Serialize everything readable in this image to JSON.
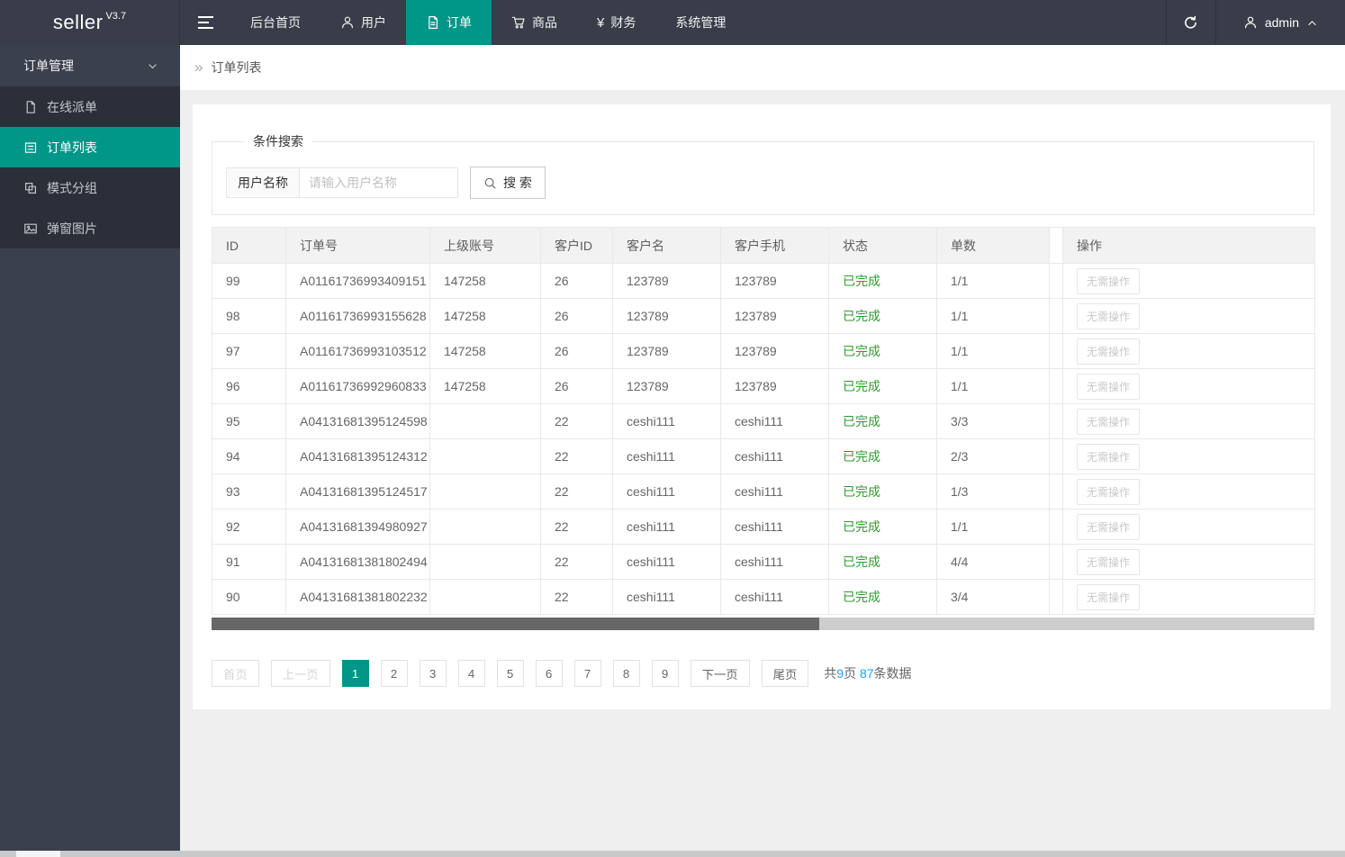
{
  "navbar": {
    "logo": "seller",
    "version": "V3.7",
    "items": [
      {
        "label": "后台首页",
        "icon": "",
        "active": false
      },
      {
        "label": "用户",
        "icon": "user",
        "active": false
      },
      {
        "label": "订单",
        "icon": "document",
        "active": true
      },
      {
        "label": "商品",
        "icon": "cart",
        "active": false
      },
      {
        "label": "财务",
        "icon": "yen",
        "active": false
      },
      {
        "label": "系统管理",
        "icon": "",
        "active": false
      }
    ],
    "username": "admin"
  },
  "sidebar": {
    "group_label": "订单管理",
    "items": [
      {
        "label": "在线派单",
        "icon": "file",
        "active": false
      },
      {
        "label": "订单列表",
        "icon": "list",
        "active": true
      },
      {
        "label": "模式分组",
        "icon": "group",
        "active": false
      },
      {
        "label": "弹窗图片",
        "icon": "image",
        "active": false
      }
    ]
  },
  "breadcrumb": {
    "icon": "»",
    "current": "订单列表"
  },
  "search": {
    "legend": "条件搜索",
    "field_label": "用户名称",
    "placeholder": "请输入用户名称",
    "button_label": "搜 索"
  },
  "table": {
    "headers": [
      "ID",
      "订单号",
      "上级账号",
      "客户ID",
      "客户名",
      "客户手机",
      "状态",
      "单数",
      "",
      "操作"
    ],
    "action_label": "无需操作",
    "rows": [
      [
        "99",
        "A01161736993409151",
        "147258",
        "26",
        "123789",
        "123789",
        "已完成",
        "1/1"
      ],
      [
        "98",
        "A01161736993155628",
        "147258",
        "26",
        "123789",
        "123789",
        "已完成",
        "1/1"
      ],
      [
        "97",
        "A01161736993103512",
        "147258",
        "26",
        "123789",
        "123789",
        "已完成",
        "1/1"
      ],
      [
        "96",
        "A01161736992960833",
        "147258",
        "26",
        "123789",
        "123789",
        "已完成",
        "1/1"
      ],
      [
        "95",
        "A04131681395124598",
        "",
        "22",
        "ceshi111",
        "ceshi111",
        "已完成",
        "3/3"
      ],
      [
        "94",
        "A04131681395124312",
        "",
        "22",
        "ceshi111",
        "ceshi111",
        "已完成",
        "2/3"
      ],
      [
        "93",
        "A04131681395124517",
        "",
        "22",
        "ceshi111",
        "ceshi111",
        "已完成",
        "1/3"
      ],
      [
        "92",
        "A04131681394980927",
        "",
        "22",
        "ceshi111",
        "ceshi111",
        "已完成",
        "1/1"
      ],
      [
        "91",
        "A04131681381802494",
        "",
        "22",
        "ceshi111",
        "ceshi111",
        "已完成",
        "4/4"
      ],
      [
        "90",
        "A04131681381802232",
        "",
        "22",
        "ceshi111",
        "ceshi111",
        "已完成",
        "3/4"
      ]
    ]
  },
  "pagination": {
    "first": "首页",
    "prev": "上一页",
    "pages": [
      "1",
      "2",
      "3",
      "4",
      "5",
      "6",
      "7",
      "8",
      "9"
    ],
    "active_page": "1",
    "next": "下一页",
    "last": "尾页",
    "summary": {
      "prefix": "共",
      "total_pages": "9",
      "mid": "页 ",
      "total_records": "87",
      "suffix": "条数据"
    }
  },
  "colors": {
    "accent": "#009688",
    "status_done": "#339933",
    "link_blue": "#1e9fff"
  }
}
